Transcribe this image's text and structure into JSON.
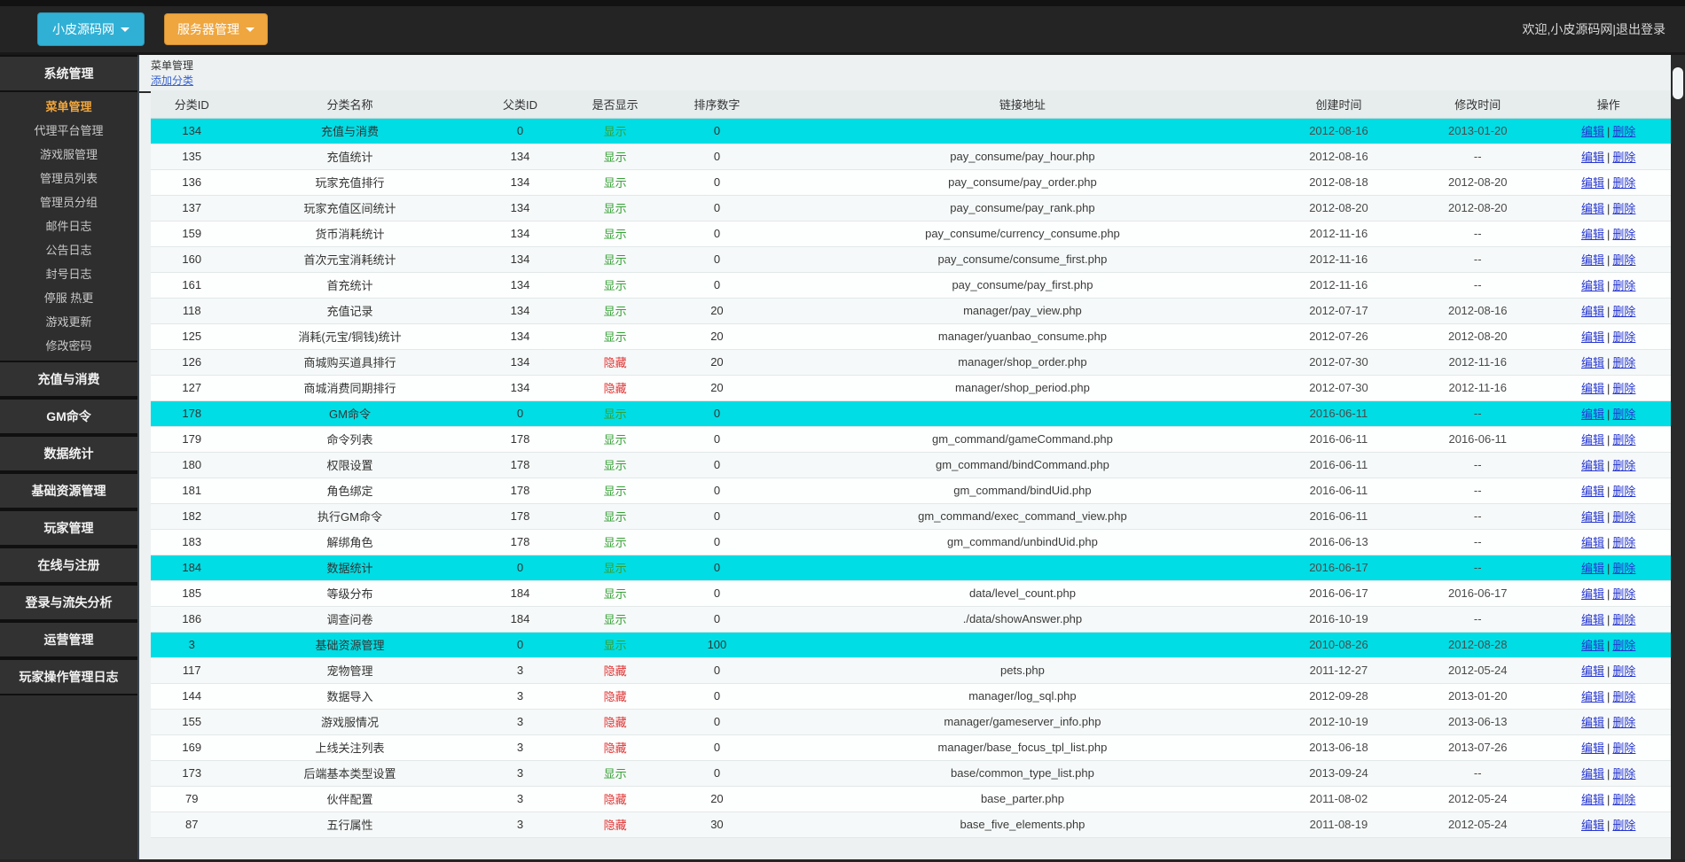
{
  "topbar": {
    "brand_label": "小皮源码网",
    "menu_label": "服务器管理",
    "welcome_prefix": "欢迎,小皮源码网",
    "separator": "|",
    "logout_label": "退出登录"
  },
  "sidebar": {
    "sections": [
      {
        "label": "系统管理",
        "items": [
          {
            "label": "菜单管理",
            "active": true
          },
          {
            "label": "代理平台管理",
            "active": false
          },
          {
            "label": "游戏服管理",
            "active": false
          },
          {
            "label": "管理员列表",
            "active": false
          },
          {
            "label": "管理员分组",
            "active": false
          },
          {
            "label": "邮件日志",
            "active": false
          },
          {
            "label": "公告日志",
            "active": false
          },
          {
            "label": "封号日志",
            "active": false
          },
          {
            "label": "停服 热更",
            "active": false
          },
          {
            "label": "游戏更新",
            "active": false
          },
          {
            "label": "修改密码",
            "active": false
          }
        ]
      },
      {
        "label": "充值与消费",
        "items": []
      },
      {
        "label": "GM命令",
        "items": []
      },
      {
        "label": "数据统计",
        "items": []
      },
      {
        "label": "基础资源管理",
        "items": []
      },
      {
        "label": "玩家管理",
        "items": []
      },
      {
        "label": "在线与注册",
        "items": []
      },
      {
        "label": "登录与流失分析",
        "items": []
      },
      {
        "label": "运营管理",
        "items": []
      },
      {
        "label": "玩家操作管理日志",
        "items": []
      }
    ]
  },
  "main": {
    "title": "菜单管理",
    "add_link": "添加分类",
    "table": {
      "columns": [
        "分类ID",
        "分类名称",
        "父类ID",
        "是否显示",
        "排序数字",
        "链接地址",
        "创建时间",
        "修改时间",
        "操作"
      ],
      "action_edit": "编辑",
      "action_separator": "|",
      "action_delete": "删除",
      "rows": [
        {
          "id": "134",
          "name": "充值与消费",
          "parent": "0",
          "visible_label": "显示",
          "visible_state": "show",
          "sort": "0",
          "link": "",
          "created": "2012-08-16",
          "modified": "2013-01-20",
          "highlighted": true
        },
        {
          "id": "135",
          "name": "充值统计",
          "parent": "134",
          "visible_label": "显示",
          "visible_state": "show",
          "sort": "0",
          "link": "pay_consume/pay_hour.php",
          "created": "2012-08-16",
          "modified": "--",
          "highlighted": false
        },
        {
          "id": "136",
          "name": "玩家充值排行",
          "parent": "134",
          "visible_label": "显示",
          "visible_state": "show",
          "sort": "0",
          "link": "pay_consume/pay_order.php",
          "created": "2012-08-18",
          "modified": "2012-08-20",
          "highlighted": false
        },
        {
          "id": "137",
          "name": "玩家充值区间统计",
          "parent": "134",
          "visible_label": "显示",
          "visible_state": "show",
          "sort": "0",
          "link": "pay_consume/pay_rank.php",
          "created": "2012-08-20",
          "modified": "2012-08-20",
          "highlighted": false
        },
        {
          "id": "159",
          "name": "货币消耗统计",
          "parent": "134",
          "visible_label": "显示",
          "visible_state": "show",
          "sort": "0",
          "link": "pay_consume/currency_consume.php",
          "created": "2012-11-16",
          "modified": "--",
          "highlighted": false
        },
        {
          "id": "160",
          "name": "首次元宝消耗统计",
          "parent": "134",
          "visible_label": "显示",
          "visible_state": "show",
          "sort": "0",
          "link": "pay_consume/consume_first.php",
          "created": "2012-11-16",
          "modified": "--",
          "highlighted": false
        },
        {
          "id": "161",
          "name": "首充统计",
          "parent": "134",
          "visible_label": "显示",
          "visible_state": "show",
          "sort": "0",
          "link": "pay_consume/pay_first.php",
          "created": "2012-11-16",
          "modified": "--",
          "highlighted": false
        },
        {
          "id": "118",
          "name": "充值记录",
          "parent": "134",
          "visible_label": "显示",
          "visible_state": "show",
          "sort": "20",
          "link": "manager/pay_view.php",
          "created": "2012-07-17",
          "modified": "2012-08-16",
          "highlighted": false
        },
        {
          "id": "125",
          "name": "消耗(元宝/铜钱)统计",
          "parent": "134",
          "visible_label": "显示",
          "visible_state": "show",
          "sort": "20",
          "link": "manager/yuanbao_consume.php",
          "created": "2012-07-26",
          "modified": "2012-08-20",
          "highlighted": false
        },
        {
          "id": "126",
          "name": "商城购买道具排行",
          "parent": "134",
          "visible_label": "隐藏",
          "visible_state": "hide",
          "sort": "20",
          "link": "manager/shop_order.php",
          "created": "2012-07-30",
          "modified": "2012-11-16",
          "highlighted": false
        },
        {
          "id": "127",
          "name": "商城消费同期排行",
          "parent": "134",
          "visible_label": "隐藏",
          "visible_state": "hide",
          "sort": "20",
          "link": "manager/shop_period.php",
          "created": "2012-07-30",
          "modified": "2012-11-16",
          "highlighted": false
        },
        {
          "id": "178",
          "name": "GM命令",
          "parent": "0",
          "visible_label": "显示",
          "visible_state": "show",
          "sort": "0",
          "link": "",
          "created": "2016-06-11",
          "modified": "--",
          "highlighted": true
        },
        {
          "id": "179",
          "name": "命令列表",
          "parent": "178",
          "visible_label": "显示",
          "visible_state": "show",
          "sort": "0",
          "link": "gm_command/gameCommand.php",
          "created": "2016-06-11",
          "modified": "2016-06-11",
          "highlighted": false
        },
        {
          "id": "180",
          "name": "权限设置",
          "parent": "178",
          "visible_label": "显示",
          "visible_state": "show",
          "sort": "0",
          "link": "gm_command/bindCommand.php",
          "created": "2016-06-11",
          "modified": "--",
          "highlighted": false
        },
        {
          "id": "181",
          "name": "角色绑定",
          "parent": "178",
          "visible_label": "显示",
          "visible_state": "show",
          "sort": "0",
          "link": "gm_command/bindUid.php",
          "created": "2016-06-11",
          "modified": "--",
          "highlighted": false
        },
        {
          "id": "182",
          "name": "执行GM命令",
          "parent": "178",
          "visible_label": "显示",
          "visible_state": "show",
          "sort": "0",
          "link": "gm_command/exec_command_view.php",
          "created": "2016-06-11",
          "modified": "--",
          "highlighted": false
        },
        {
          "id": "183",
          "name": "解绑角色",
          "parent": "178",
          "visible_label": "显示",
          "visible_state": "show",
          "sort": "0",
          "link": "gm_command/unbindUid.php",
          "created": "2016-06-13",
          "modified": "--",
          "highlighted": false
        },
        {
          "id": "184",
          "name": "数据统计",
          "parent": "0",
          "visible_label": "显示",
          "visible_state": "show",
          "sort": "0",
          "link": "",
          "created": "2016-06-17",
          "modified": "--",
          "highlighted": true
        },
        {
          "id": "185",
          "name": "等级分布",
          "parent": "184",
          "visible_label": "显示",
          "visible_state": "show",
          "sort": "0",
          "link": "data/level_count.php",
          "created": "2016-06-17",
          "modified": "2016-06-17",
          "highlighted": false
        },
        {
          "id": "186",
          "name": "调查问卷",
          "parent": "184",
          "visible_label": "显示",
          "visible_state": "show",
          "sort": "0",
          "link": "./data/showAnswer.php",
          "created": "2016-10-19",
          "modified": "--",
          "highlighted": false
        },
        {
          "id": "3",
          "name": "基础资源管理",
          "parent": "0",
          "visible_label": "显示",
          "visible_state": "show",
          "sort": "100",
          "link": "",
          "created": "2010-08-26",
          "modified": "2012-08-28",
          "highlighted": true
        },
        {
          "id": "117",
          "name": "宠物管理",
          "parent": "3",
          "visible_label": "隐藏",
          "visible_state": "hide",
          "sort": "0",
          "link": "pets.php",
          "created": "2011-12-27",
          "modified": "2012-05-24",
          "highlighted": false
        },
        {
          "id": "144",
          "name": "数据导入",
          "parent": "3",
          "visible_label": "隐藏",
          "visible_state": "hide",
          "sort": "0",
          "link": "manager/log_sql.php",
          "created": "2012-09-28",
          "modified": "2013-01-20",
          "highlighted": false
        },
        {
          "id": "155",
          "name": "游戏服情况",
          "parent": "3",
          "visible_label": "隐藏",
          "visible_state": "hide",
          "sort": "0",
          "link": "manager/gameserver_info.php",
          "created": "2012-10-19",
          "modified": "2013-06-13",
          "highlighted": false
        },
        {
          "id": "169",
          "name": "上线关注列表",
          "parent": "3",
          "visible_label": "隐藏",
          "visible_state": "hide",
          "sort": "0",
          "link": "manager/base_focus_tpl_list.php",
          "created": "2013-06-18",
          "modified": "2013-07-26",
          "highlighted": false
        },
        {
          "id": "173",
          "name": "后端基本类型设置",
          "parent": "3",
          "visible_label": "显示",
          "visible_state": "show",
          "sort": "0",
          "link": "base/common_type_list.php",
          "created": "2013-09-24",
          "modified": "--",
          "highlighted": false
        },
        {
          "id": "79",
          "name": "伙伴配置",
          "parent": "3",
          "visible_label": "隐藏",
          "visible_state": "hide",
          "sort": "20",
          "link": "base_parter.php",
          "created": "2011-08-02",
          "modified": "2012-05-24",
          "highlighted": false
        },
        {
          "id": "87",
          "name": "五行属性",
          "parent": "3",
          "visible_label": "隐藏",
          "visible_state": "hide",
          "sort": "30",
          "link": "base_five_elements.php",
          "created": "2011-08-19",
          "modified": "2012-05-24",
          "highlighted": false
        }
      ]
    }
  },
  "colors": {
    "highlight_row": "#00dde4",
    "show_green": "#35a035",
    "hide_red": "#e03434",
    "action_link_blue": "#2636d0",
    "brand_blue": "#31b0d5",
    "brand_orange": "#efa63e",
    "active_item_orange": "#f0a63c"
  }
}
